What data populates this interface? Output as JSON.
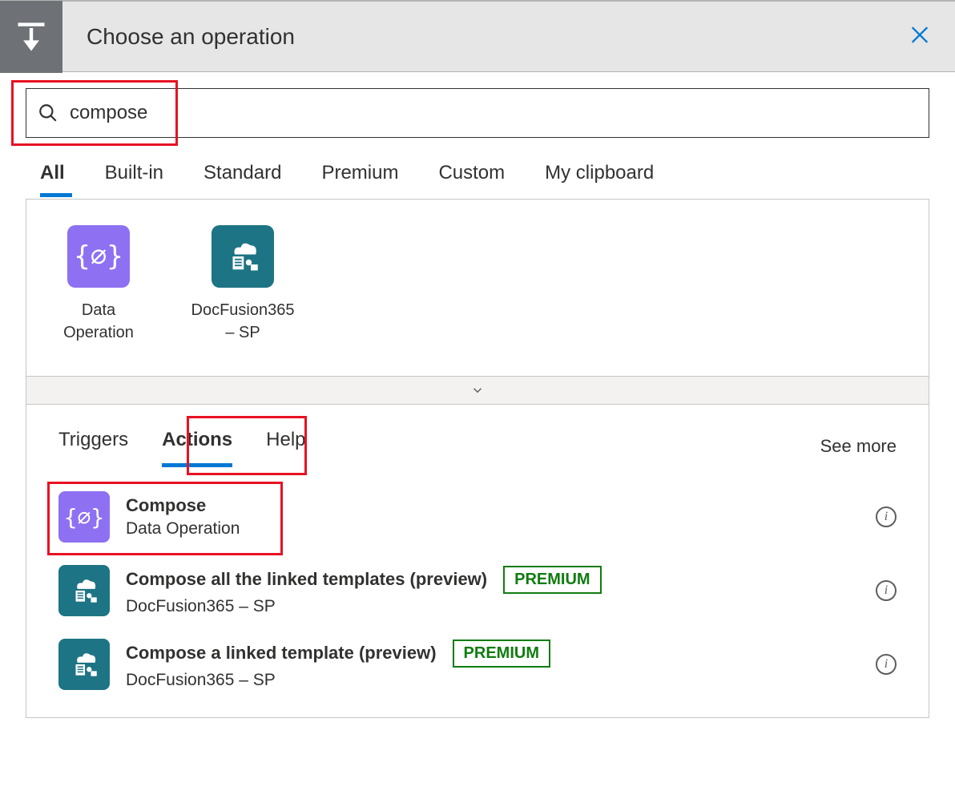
{
  "header": {
    "title": "Choose an operation"
  },
  "search": {
    "value": "compose"
  },
  "category_tabs": [
    {
      "label": "All",
      "active": true
    },
    {
      "label": "Built-in",
      "active": false
    },
    {
      "label": "Standard",
      "active": false
    },
    {
      "label": "Premium",
      "active": false
    },
    {
      "label": "Custom",
      "active": false
    },
    {
      "label": "My clipboard",
      "active": false
    }
  ],
  "connectors": [
    {
      "label": "Data Operation",
      "color": "purple",
      "icon": "code-braces"
    },
    {
      "label": "DocFusion365 – SP",
      "color": "teal",
      "icon": "docfusion"
    }
  ],
  "subtabs": [
    {
      "label": "Triggers",
      "active": false
    },
    {
      "label": "Actions",
      "active": true
    },
    {
      "label": "Help",
      "active": false
    }
  ],
  "see_more": "See more",
  "actions": [
    {
      "title": "Compose",
      "subtitle": "Data Operation",
      "color": "purple",
      "icon": "code-braces",
      "premium": false
    },
    {
      "title": "Compose all the linked templates (preview)",
      "subtitle": "DocFusion365 – SP",
      "color": "teal",
      "icon": "docfusion",
      "premium": true
    },
    {
      "title": "Compose a linked template (preview)",
      "subtitle": "DocFusion365 – SP",
      "color": "teal",
      "icon": "docfusion",
      "premium": true
    }
  ],
  "premium_label": "PREMIUM"
}
